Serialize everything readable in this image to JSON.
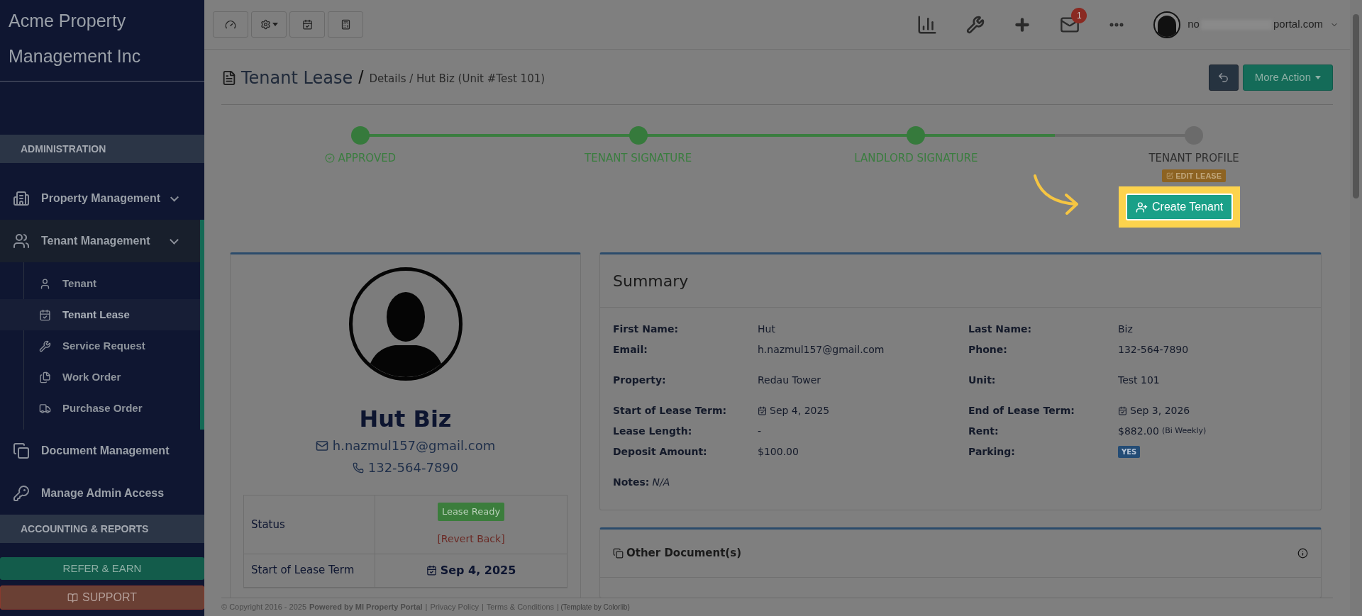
{
  "sidebar": {
    "brand_lines": [
      "Acme Property",
      "Management Inc"
    ],
    "sections": [
      {
        "kind": "header",
        "label": "ADMINISTRATION"
      },
      {
        "kind": "item",
        "label": "Property Management",
        "expanded": false,
        "has_caret": true
      },
      {
        "kind": "item",
        "label": "Tenant Management",
        "expanded": true,
        "has_caret": true,
        "children": [
          {
            "label": "Tenant",
            "selected": false
          },
          {
            "label": "Tenant Lease",
            "selected": true
          },
          {
            "label": "Service Request",
            "selected": false
          },
          {
            "label": "Work Order",
            "selected": false
          },
          {
            "label": "Purchase Order",
            "selected": false
          }
        ]
      },
      {
        "kind": "item",
        "label": "Document Management",
        "expanded": false,
        "has_caret": false
      },
      {
        "kind": "item",
        "label": "Manage Admin Access",
        "expanded": false,
        "has_caret": false
      },
      {
        "kind": "header",
        "label": "ACCOUNTING & REPORTS"
      }
    ],
    "refer_button": "REFER & EARN",
    "support_button": "SUPPORT"
  },
  "topbar": {
    "notification_count": "1",
    "user_email_start": "no",
    "user_email_end": "portal.com"
  },
  "page": {
    "title": "Tenant Lease",
    "separator": "/",
    "breadcrumb": "Details / Hut Biz (Unit #Test 101)",
    "more_action": "More Action"
  },
  "steps": [
    {
      "label": "APPROVED",
      "done": true,
      "check": true
    },
    {
      "label": "TENANT SIGNATURE",
      "done": true,
      "check": false
    },
    {
      "label": "LANDLORD SIGNATURE",
      "done": true,
      "check": false
    },
    {
      "label": "TENANT PROFILE",
      "done": false,
      "check": false,
      "badge": "EDIT LEASE"
    }
  ],
  "create_tenant": "Create Tenant",
  "profile": {
    "name": "Hut Biz",
    "email": "h.nazmul157@gmail.com",
    "phone": "132-564-7890",
    "table": [
      {
        "label": "Status",
        "kind": "status",
        "badge": "Lease Ready",
        "link": "[Revert Back]"
      },
      {
        "label": "Start of Lease Term",
        "kind": "date",
        "value": "Sep 4, 2025"
      }
    ]
  },
  "summary": {
    "title": "Summary",
    "groups": [
      [
        [
          {
            "label": "First Name:",
            "value": "Hut",
            "kind": "text"
          },
          {
            "label": "Last Name:",
            "value": "Biz",
            "kind": "text"
          }
        ],
        [
          {
            "label": "Email:",
            "value": "h.nazmul157@gmail.com",
            "kind": "text"
          },
          {
            "label": "Phone:",
            "value": "132-564-7890",
            "kind": "text"
          }
        ]
      ],
      [
        [
          {
            "label": "Property:",
            "value": "Redau Tower",
            "kind": "text"
          },
          {
            "label": "Unit:",
            "value": "Test 101",
            "kind": "text"
          }
        ]
      ],
      [
        [
          {
            "label": "Start of Lease Term:",
            "value": "Sep 4, 2025",
            "kind": "date"
          },
          {
            "label": "End of Lease Term:",
            "value": "Sep 3, 2026",
            "kind": "date"
          }
        ],
        [
          {
            "label": "Lease Length:",
            "value": "-",
            "kind": "text"
          },
          {
            "label": "Rent:",
            "value": "$882.00",
            "note": "(Bi Weekly)",
            "kind": "text"
          }
        ],
        [
          {
            "label": "Deposit Amount:",
            "value": "$100.00",
            "kind": "text"
          },
          {
            "label": "Parking:",
            "value": "YES",
            "kind": "badge"
          }
        ]
      ]
    ],
    "notes_label": "Notes:",
    "notes_value": "N/A"
  },
  "documents": {
    "title": "Other Document(s)"
  },
  "footer": {
    "copyright": "© Copyright 2016 - 2025",
    "powered": "Powered by MI Property Portal",
    "sep1": "|",
    "privacy": "Privacy Policy",
    "sep2": "|",
    "terms": "Terms & Conditions",
    "template": "| (Template by Colorlib)"
  }
}
